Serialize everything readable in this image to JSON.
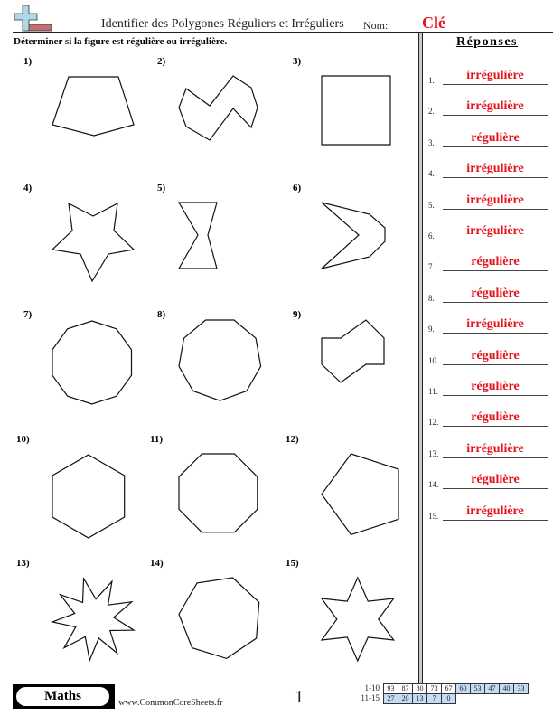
{
  "header": {
    "logo_icon": "plus-and-bar-icon",
    "title": "Identifier des Polygones Réguliers et Irréguliers",
    "name_label": "Nom:",
    "name_value": "Clé"
  },
  "instructions": "Déterminer si la figure est régulière ou irrégulière.",
  "problems": [
    {
      "label": "1)",
      "shape": "irregular-pentagon"
    },
    {
      "label": "2)",
      "shape": "irregular-zigzag-polygon"
    },
    {
      "label": "3)",
      "shape": "square"
    },
    {
      "label": "4)",
      "shape": "irregular-star"
    },
    {
      "label": "5)",
      "shape": "bowtie-hexagon"
    },
    {
      "label": "6)",
      "shape": "chevron-polygon"
    },
    {
      "label": "7)",
      "shape": "regular-decagon"
    },
    {
      "label": "8)",
      "shape": "regular-nonagon"
    },
    {
      "label": "9)",
      "shape": "irregular-hexagon"
    },
    {
      "label": "10)",
      "shape": "regular-hexagon"
    },
    {
      "label": "11)",
      "shape": "regular-octagon"
    },
    {
      "label": "12)",
      "shape": "regular-pentagon"
    },
    {
      "label": "13)",
      "shape": "irregular-nine-point-star"
    },
    {
      "label": "14)",
      "shape": "regular-heptagon"
    },
    {
      "label": "15)",
      "shape": "six-point-star"
    }
  ],
  "answers": {
    "title": "Réponses",
    "items": [
      {
        "num": "1.",
        "value": "irrégulière"
      },
      {
        "num": "2.",
        "value": "irrégulière"
      },
      {
        "num": "3.",
        "value": "régulière"
      },
      {
        "num": "4.",
        "value": "irrégulière"
      },
      {
        "num": "5.",
        "value": "irrégulière"
      },
      {
        "num": "6.",
        "value": "irrégulière"
      },
      {
        "num": "7.",
        "value": "régulière"
      },
      {
        "num": "8.",
        "value": "régulière"
      },
      {
        "num": "9.",
        "value": "irrégulière"
      },
      {
        "num": "10.",
        "value": "régulière"
      },
      {
        "num": "11.",
        "value": "régulière"
      },
      {
        "num": "12.",
        "value": "régulière"
      },
      {
        "num": "13.",
        "value": "irrégulière"
      },
      {
        "num": "14.",
        "value": "régulière"
      },
      {
        "num": "15.",
        "value": "irrégulière"
      }
    ]
  },
  "footer": {
    "subject": "Maths",
    "website": "www.CommonCoreSheets.fr",
    "page_number": "1",
    "score_rows": [
      {
        "label": "1-10",
        "scores": [
          "93",
          "87",
          "80",
          "73",
          "67",
          "60",
          "53",
          "47",
          "40",
          "33"
        ]
      },
      {
        "label": "11-15",
        "scores": [
          "27",
          "20",
          "13",
          "7",
          "0"
        ]
      }
    ]
  },
  "colors": {
    "answer_red": "#e8121b",
    "score_blue": "#c6dcf5",
    "logo_cross": "#add8e6",
    "logo_bar": "#c07070"
  }
}
